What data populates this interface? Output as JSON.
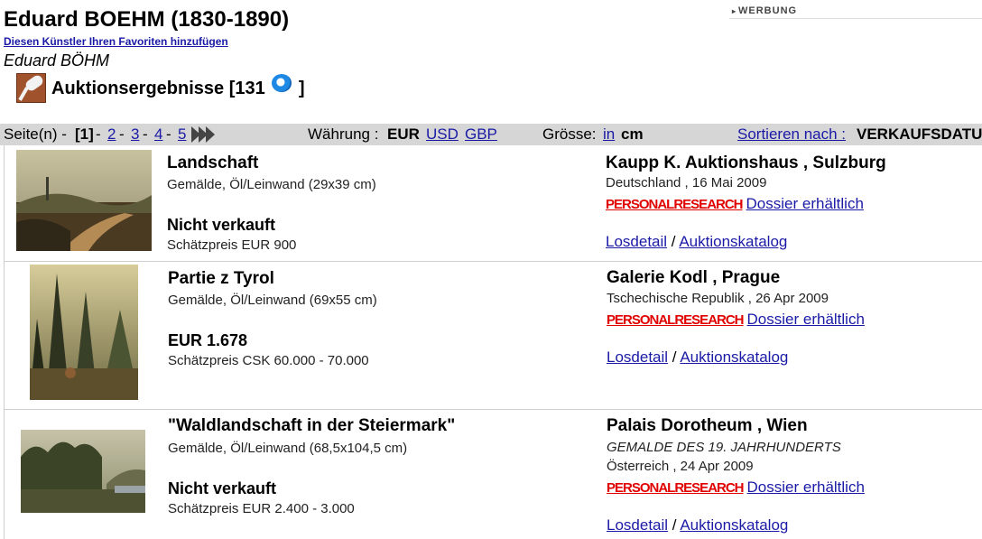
{
  "header": {
    "artist": "Eduard BOEHM (1830-1890)",
    "favorites_link": "Diesen Künstler Ihren Favoriten hinzufügen",
    "alt_name": "Eduard BÖHM",
    "auction_results": {
      "label": "Auktionsergebnisse [131",
      "close": "]"
    },
    "ad_label": "WERBUNG"
  },
  "toolbar": {
    "pages_label": "Seite(n) -",
    "current_page": "[1]",
    "dash": "-",
    "pages": [
      "2",
      "3",
      "4",
      "5"
    ],
    "currency_label": "Währung :",
    "currency_active": "EUR",
    "currencies": [
      "USD",
      "GBP"
    ],
    "size_label": "Grösse:",
    "size_link": "in",
    "size_active": "cm",
    "sort_link": "Sortieren nach :",
    "sort_value": "VERKAUFSDATUM"
  },
  "lots": [
    {
      "title": "Landschaft",
      "medium": "Gemälde, Öl/Leinwand (29x39 cm)",
      "price": "Nicht verkauft",
      "estimate": "Schätzpreis EUR 900",
      "house": "Kaupp K. Auktionshaus , Sulzburg",
      "sale_title": "",
      "location_date": "Deutschland , 16 Mai 2009",
      "personal_research": "PERSONALRESEARCH",
      "dossier": "Dossier erhältlich",
      "lot_link": "Losdetail",
      "separator": "/",
      "catalog_link": "Auktionskatalog"
    },
    {
      "title": "Partie z Tyrol",
      "medium": "Gemälde, Öl/Leinwand (69x55 cm)",
      "price": "EUR 1.678",
      "estimate": "Schätzpreis CSK 60.000 - 70.000",
      "house": "Galerie Kodl , Prague",
      "sale_title": "",
      "location_date": "Tschechische Republik , 26 Apr 2009",
      "personal_research": "PERSONALRESEARCH",
      "dossier": "Dossier erhältlich",
      "lot_link": "Losdetail",
      "separator": "/",
      "catalog_link": "Auktionskatalog"
    },
    {
      "title": "\"Waldlandschaft in der Steiermark\"",
      "medium": "Gemälde, Öl/Leinwand (68,5x104,5 cm)",
      "price": "Nicht verkauft",
      "estimate": "Schätzpreis EUR 2.400 - 3.000",
      "house": "Palais Dorotheum , Wien",
      "sale_title": "GEMALDE DES 19. JAHRHUNDERTS",
      "location_date": "Österreich , 24 Apr 2009",
      "personal_research": "PERSONALRESEARCH",
      "dossier": "Dossier erhältlich",
      "lot_link": "Losdetail",
      "separator": "/",
      "catalog_link": "Auktionskatalog"
    }
  ]
}
